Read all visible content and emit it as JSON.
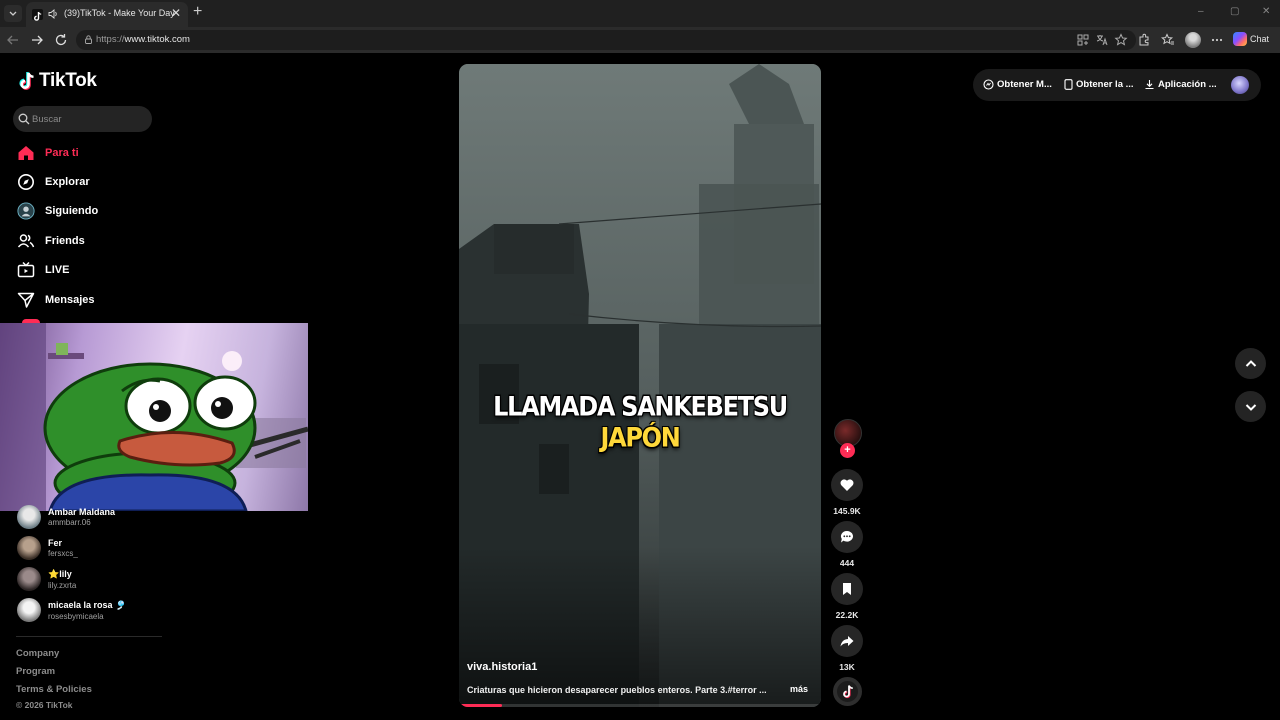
{
  "browser": {
    "tab_title": "(39)TikTok - Make Your Day",
    "tab_close": "✕",
    "new_tab": "+",
    "url_prefix": "https://",
    "url_host": "www.tiktok.com",
    "chat_label": "Chat",
    "window_controls": [
      "–",
      "▢",
      "✕"
    ]
  },
  "sidebar": {
    "logo_text": "TikTok",
    "search_placeholder": "Buscar",
    "nav": [
      {
        "label": "Para ti",
        "icon": "home-icon",
        "active": true
      },
      {
        "label": "Explorar",
        "icon": "compass-icon"
      },
      {
        "label": "Siguiendo",
        "icon": "following-avatar-icon"
      },
      {
        "label": "Friends",
        "icon": "friends-icon"
      },
      {
        "label": "LIVE",
        "icon": "live-tv-icon"
      },
      {
        "label": "Mensajes",
        "icon": "send-icon"
      }
    ],
    "following": [
      {
        "name": "Ambar Maldana",
        "handle": "ammbarr.06"
      },
      {
        "name": "Fer",
        "handle": "fersxcs_"
      },
      {
        "name": "⭐lily",
        "handle": "lily.zxrta"
      },
      {
        "name": "micaela la rosa 🎐",
        "handle": "rosesbymicaela"
      }
    ],
    "footer_links": [
      "Company",
      "Program",
      "Terms & Policies"
    ],
    "copyright": "© 2026 TikTok"
  },
  "video": {
    "overlay_white": "LLAMADA SANKEBETSU",
    "overlay_yellow": "JAPÓN",
    "username": "viva.historia1",
    "description": "Criaturas que hicieron desaparecer pueblos enteros. Parte 3.#terror ...",
    "more_label": "más",
    "progress": 0.12
  },
  "actions": {
    "follow_symbol": "+",
    "likes": "145.9K",
    "comments": "444",
    "saves": "22.2K",
    "shares": "13K"
  },
  "top_right": {
    "item1": "Obtener M...",
    "item2": "Obtener la ...",
    "item3": "Aplicación ..."
  },
  "colors": {
    "accent": "#fe2c55",
    "overlay_highlight": "#ffd83a",
    "page_bg": "#000000"
  }
}
